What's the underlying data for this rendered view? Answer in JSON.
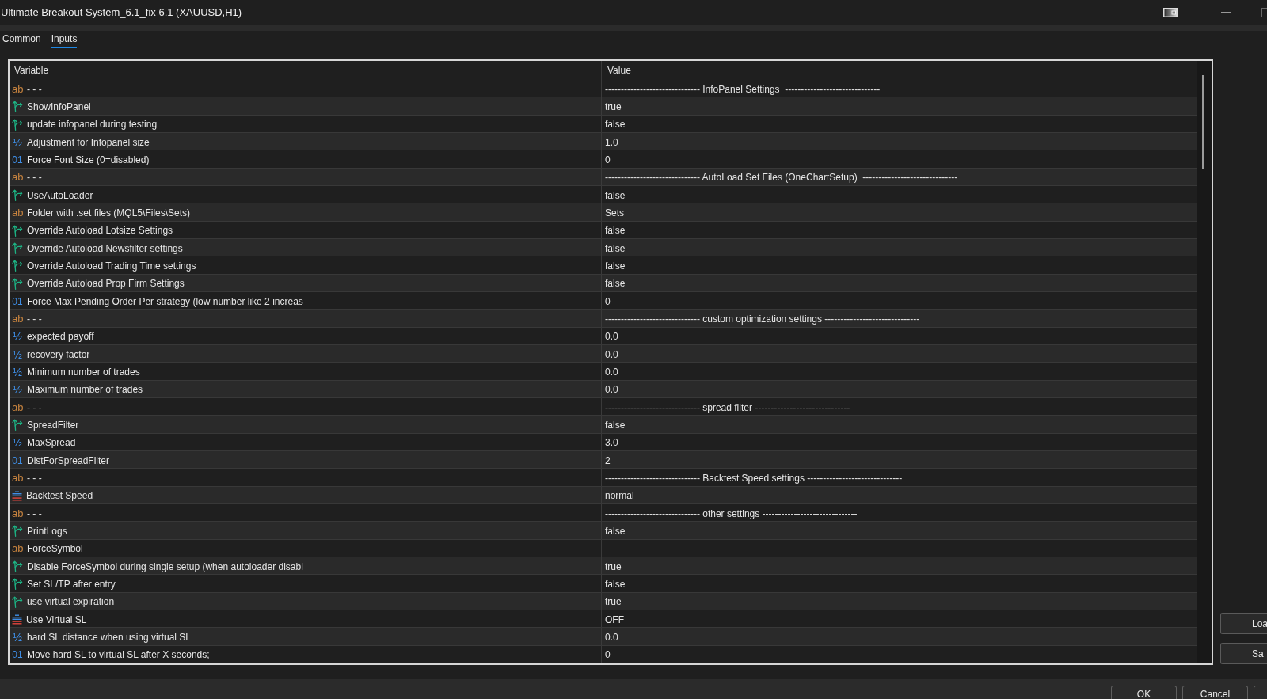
{
  "window": {
    "title": "Ultimate Breakout System_6.1_fix 6.1 (XAUUSD,H1)"
  },
  "tabs": [
    {
      "label": "Common",
      "selected": false
    },
    {
      "label": "Inputs",
      "selected": true
    }
  ],
  "inputs_table": {
    "columns": [
      "Variable",
      "Value"
    ],
    "rows": [
      {
        "kind": "string",
        "type_icon": "ab",
        "variable": "- - -",
        "value": "------------------------------ InfoPanel Settings  ------------------------------"
      },
      {
        "kind": "bool",
        "variable": "ShowInfoPanel",
        "value": "true"
      },
      {
        "kind": "bool",
        "variable": "update infopanel during testing",
        "value": "false"
      },
      {
        "kind": "double",
        "type_icon": "½",
        "variable": "Adjustment for Infopanel size",
        "value": "1.0"
      },
      {
        "kind": "int",
        "type_icon": "01",
        "variable": "Force Font Size (0=disabled)",
        "value": "0"
      },
      {
        "kind": "string",
        "type_icon": "ab",
        "variable": "- - -",
        "value": "------------------------------ AutoLoad Set Files (OneChartSetup)  ------------------------------"
      },
      {
        "kind": "bool",
        "variable": "UseAutoLoader",
        "value": "false"
      },
      {
        "kind": "string",
        "type_icon": "ab",
        "variable": "Folder with .set files (MQL5\\Files\\Sets)",
        "value": "Sets"
      },
      {
        "kind": "bool",
        "variable": "Override Autoload Lotsize Settings",
        "value": "false"
      },
      {
        "kind": "bool",
        "variable": "Override Autoload Newsfilter settings",
        "value": "false"
      },
      {
        "kind": "bool",
        "variable": "Override Autoload Trading Time settings",
        "value": "false"
      },
      {
        "kind": "bool",
        "variable": "Override Autoload Prop Firm Settings",
        "value": "false"
      },
      {
        "kind": "int",
        "type_icon": "01",
        "variable": "Force Max Pending Order Per strategy (low number like 2 increas",
        "value": "0"
      },
      {
        "kind": "string",
        "type_icon": "ab",
        "variable": "- - -",
        "value": "------------------------------ custom optimization settings ------------------------------"
      },
      {
        "kind": "double",
        "type_icon": "½",
        "variable": "expected payoff",
        "value": "0.0"
      },
      {
        "kind": "double",
        "type_icon": "½",
        "variable": "recovery factor",
        "value": "0.0"
      },
      {
        "kind": "double",
        "type_icon": "½",
        "variable": "Minimum number of trades",
        "value": "0.0"
      },
      {
        "kind": "double",
        "type_icon": "½",
        "variable": "Maximum number of trades",
        "value": "0.0"
      },
      {
        "kind": "string",
        "type_icon": "ab",
        "variable": "- - -",
        "value": "------------------------------ spread filter ------------------------------"
      },
      {
        "kind": "bool",
        "variable": "SpreadFilter",
        "value": "false"
      },
      {
        "kind": "double",
        "type_icon": "½",
        "variable": "MaxSpread",
        "value": "3.0"
      },
      {
        "kind": "int",
        "type_icon": "01",
        "variable": "DistForSpreadFilter",
        "value": "2"
      },
      {
        "kind": "string",
        "type_icon": "ab",
        "variable": "- - -",
        "value": "------------------------------ Backtest Speed settings ------------------------------"
      },
      {
        "kind": "enum",
        "variable": "Backtest Speed",
        "value": "normal"
      },
      {
        "kind": "string",
        "type_icon": "ab",
        "variable": "- - -",
        "value": "------------------------------ other settings ------------------------------"
      },
      {
        "kind": "bool",
        "variable": "PrintLogs",
        "value": "false"
      },
      {
        "kind": "string",
        "type_icon": "ab",
        "variable": "ForceSymbol"
      },
      {
        "kind": "bool",
        "variable": "Disable ForceSymbol during single setup (when autoloader disabl",
        "value": "true"
      },
      {
        "kind": "bool",
        "variable": "Set SL/TP after entry",
        "value": "false"
      },
      {
        "kind": "bool",
        "variable": "use virtual expiration",
        "value": "true"
      },
      {
        "kind": "enum",
        "variable": "Use Virtual SL",
        "value": "OFF"
      },
      {
        "kind": "double",
        "type_icon": "½",
        "variable": "hard SL distance when using virtual SL",
        "value": "0.0"
      },
      {
        "kind": "int",
        "type_icon": "01",
        "variable": "Move hard SL to virtual SL after X seconds;",
        "value": "0"
      }
    ]
  },
  "side_buttons": [
    "Loa",
    "Sa"
  ],
  "dialog_buttons": [
    "OK",
    "Cancel"
  ]
}
